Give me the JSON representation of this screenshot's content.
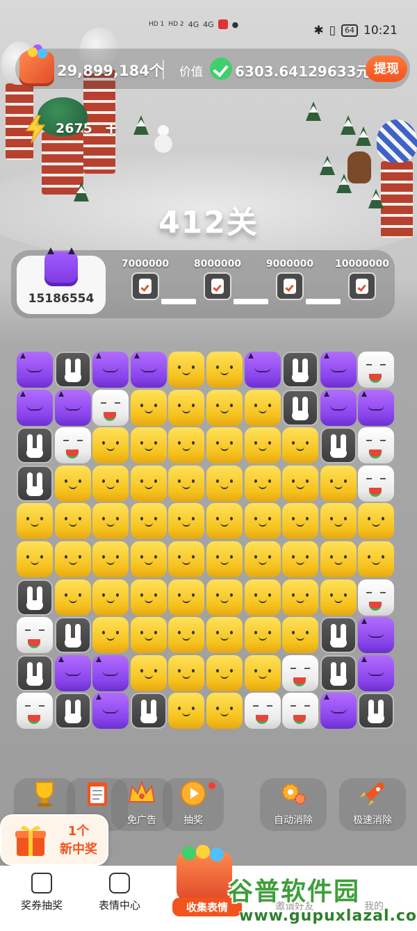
{
  "status_bar": {
    "left_indicators": [
      "HD 1",
      "HD 2",
      "4G",
      "4G"
    ],
    "battery": "64",
    "time": "10:21"
  },
  "top_bar": {
    "coins": "29,899,184个",
    "value_label": "价值",
    "value": "6303.64129633元",
    "withdraw_label": "提现"
  },
  "energy": {
    "count": "2675",
    "plus": "+"
  },
  "level": {
    "title": "412关"
  },
  "progress": {
    "current_score": "15186554",
    "milestones": [
      {
        "label": "7000000"
      },
      {
        "label": "8000000"
      },
      {
        "label": "9000000"
      },
      {
        "label": "10000000"
      }
    ]
  },
  "board": {
    "legend": {
      "Y": "yellow",
      "P": "purple",
      "W": "white",
      "B": "bunny"
    },
    "rows": [
      "PBPPYYPBPW",
      "PPWYYYYBPP",
      "BWYYYYYYBW",
      "BYYYYYYYYW",
      "YYYYYYYYYY",
      "YYYYYYYYYY",
      "BYYYYYYYYW",
      "WBYYYYYYBP",
      "BPPYYYYWBP",
      "WBPBYYWWPB"
    ]
  },
  "tools": {
    "trophy": {
      "icon": "trophy-icon"
    },
    "tasks": {
      "icon": "clipboard-icon"
    },
    "ad_free": {
      "label": "免广告",
      "icon": "crown-icon"
    },
    "lottery": {
      "label": "抽奖",
      "icon": "disc-icon"
    },
    "auto_clear": {
      "label": "自动消除",
      "icon": "gear-cluster-icon"
    },
    "fast_clear": {
      "label": "极速消除",
      "icon": "rocket-icon"
    }
  },
  "prize_popup": {
    "line1": "1个",
    "line2": "新中奖"
  },
  "bottom_nav": {
    "items": [
      {
        "label": "奖券抽奖",
        "icon": "gift-box-icon"
      },
      {
        "label": "表情中心",
        "icon": "smiley-icon"
      }
    ],
    "collect_label": "收集表情",
    "faded_items": [
      "邀请好友",
      "我的"
    ]
  },
  "watermark": {
    "cn": "谷普软件园",
    "url": "www.gupuxlazal.com"
  },
  "colors": {
    "accent": "#f2541e",
    "yellow_tile": "#f6c31e",
    "purple_tile": "#8a45ec",
    "green_check": "#3fcf6b",
    "watermark_green": "#3d9f3a"
  }
}
